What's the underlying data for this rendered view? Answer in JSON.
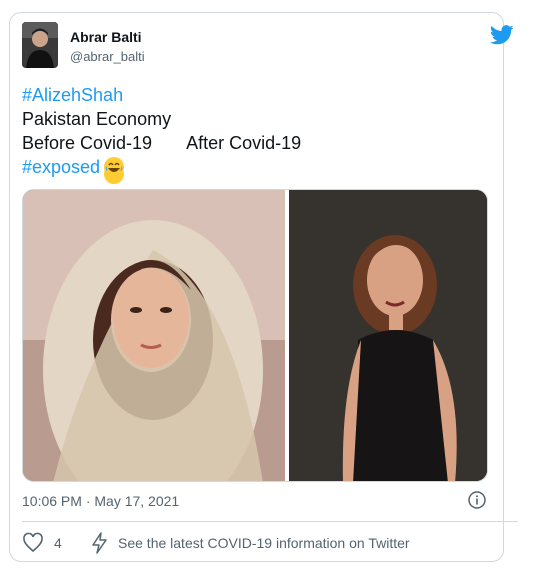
{
  "tweet": {
    "author_name": "Abrar Balti",
    "author_handle": "@abrar_balti",
    "lines": {
      "hashtag1": "#AlizehShah",
      "line2": "Pakistan Economy",
      "before": "Before Covid-19",
      "after": "After Covid-19",
      "hashtag2": "#exposed"
    },
    "emoji": "😂",
    "timestamp": "10:06 PM · May 17, 2021",
    "like_count": "4",
    "covid_notice": "See the latest COVID-19 information on Twitter"
  },
  "colors": {
    "link": "#1d9bf0",
    "text": "#0f1419",
    "muted": "#536471",
    "border": "#cfd9de"
  },
  "icons": [
    "twitter-bird-icon",
    "info-icon",
    "heart-icon",
    "bolt-icon",
    "laughing-emoji-icon"
  ]
}
